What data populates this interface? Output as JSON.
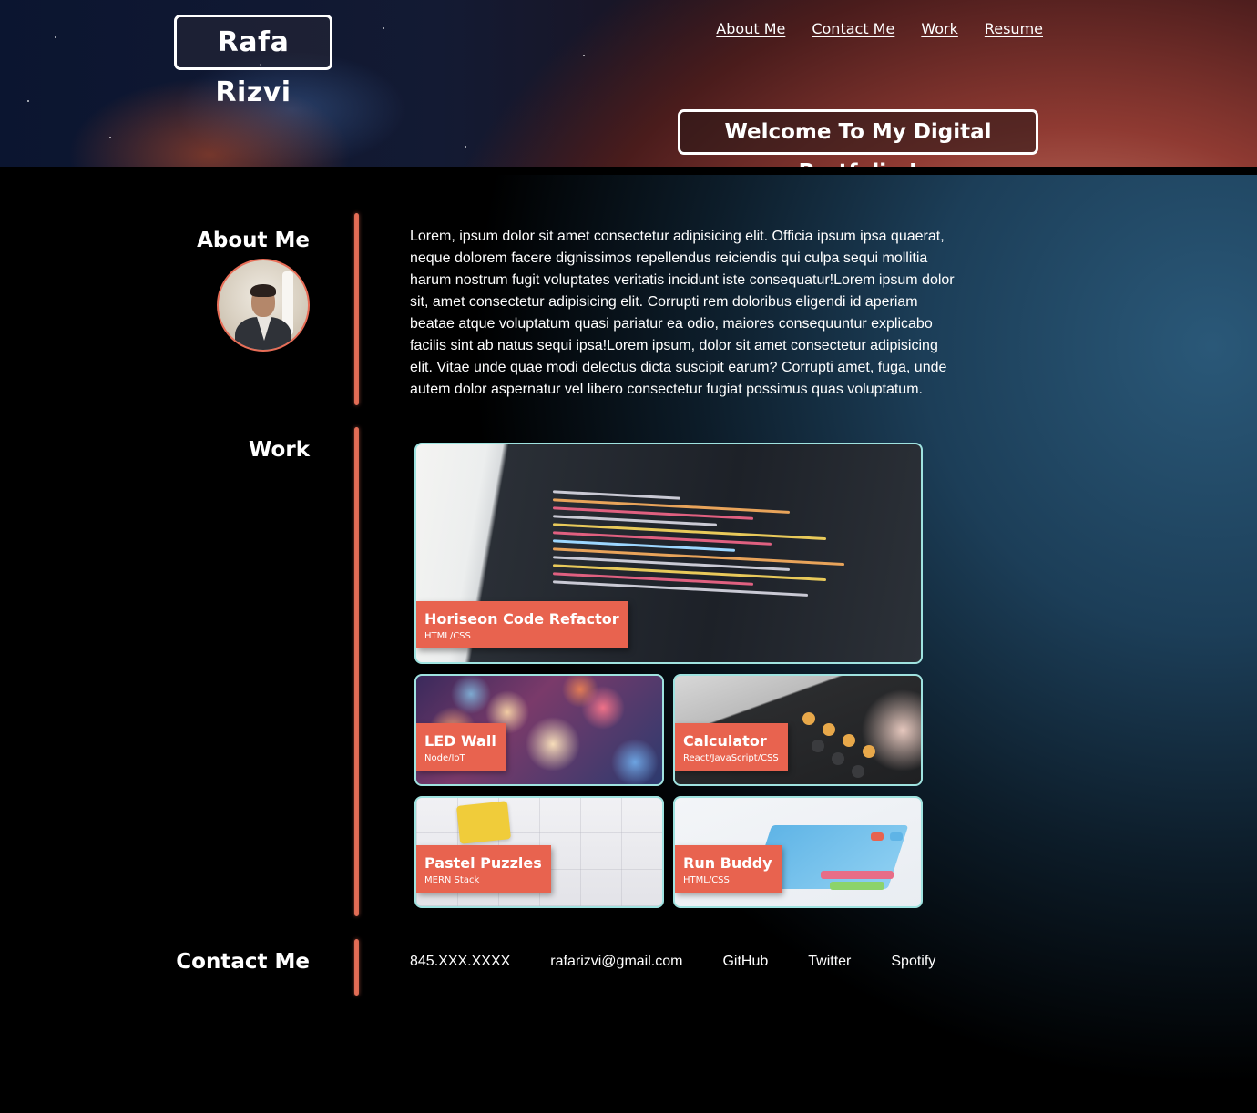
{
  "header": {
    "brand": "Rafa Rizvi",
    "nav": [
      "About Me",
      "Contact Me",
      "Work",
      "Resume"
    ],
    "welcome": "Welcome To My Digital Portfolio !"
  },
  "about": {
    "heading": "About Me",
    "text": "Lorem, ipsum dolor sit amet consectetur adipisicing elit. Officia ipsum ipsa quaerat, neque dolorem facere dignissimos repellendus reiciendis qui culpa sequi mollitia harum nostrum fugit voluptates veritatis incidunt iste consequatur!Lorem ipsum dolor sit, amet consectetur adipisicing elit. Corrupti rem doloribus eligendi id aperiam beatae atque voluptatum quasi pariatur ea odio, maiores consequuntur explicabo facilis sint ab natus sequi ipsa!Lorem ipsum, dolor sit amet consectetur adipisicing elit. Vitae unde quae modi delectus dicta suscipit earum? Corrupti amet, fuga, unde autem dolor aspernatur vel libero consectetur fugiat possimus quas voluptatum."
  },
  "work": {
    "heading": "Work",
    "projects": [
      {
        "title": "Horiseon Code Refactor",
        "tech": "HTML/CSS"
      },
      {
        "title": "LED Wall",
        "tech": "Node/IoT"
      },
      {
        "title": "Calculator",
        "tech": "React/JavaScript/CSS"
      },
      {
        "title": "Pastel Puzzles",
        "tech": "MERN Stack"
      },
      {
        "title": "Run Buddy",
        "tech": "HTML/CSS"
      }
    ]
  },
  "contact": {
    "heading": "Contact Me",
    "items": [
      "845.XXX.XXXX",
      "rafarizvi@gmail.com",
      "GitHub",
      "Twitter",
      "Spotify"
    ]
  },
  "colors": {
    "accent": "#e8634f",
    "card_border": "#9fe3e0",
    "text": "#ffffff"
  }
}
